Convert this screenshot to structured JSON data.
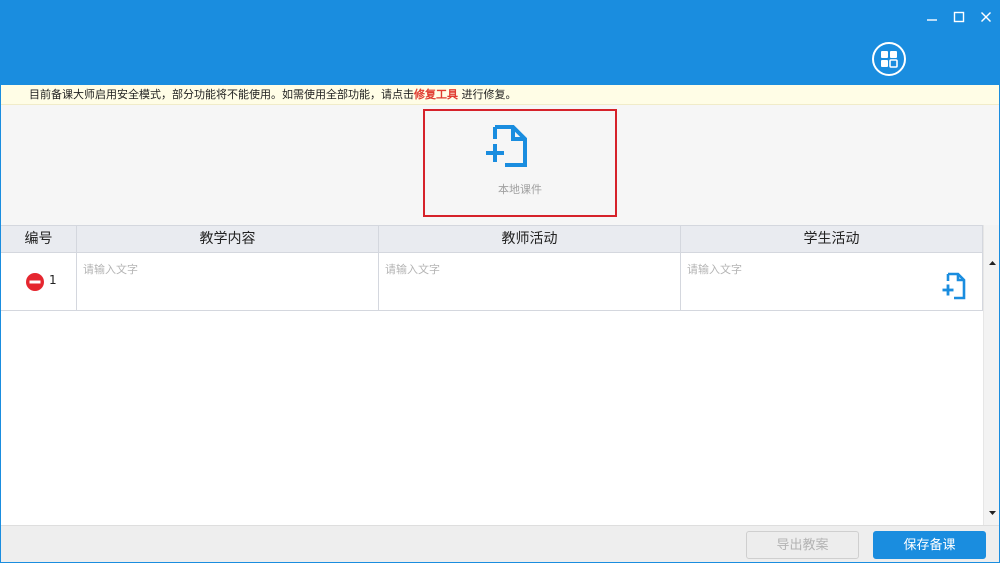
{
  "window": {
    "controls": {
      "minimize": "—",
      "maximize": "☐",
      "close": "✕"
    },
    "apps_icon": "grid-apps-icon",
    "accent_color": "#1a8ddf"
  },
  "notice": {
    "text_before": "目前备课大师启用安全模式，部分功能将不能使用。如需使用全部功能，请点击",
    "link_text": "修复工具",
    "text_after": " 进行修复。",
    "link_color": "#e03c31"
  },
  "upload": {
    "icon": "add-document-icon",
    "label": "本地课件",
    "highlight_color": "#d6222a"
  },
  "table": {
    "columns": [
      "编号",
      "教学内容",
      "教师活动",
      "学生活动"
    ],
    "rows": [
      {
        "number": "1",
        "teaching_content": {
          "value": "",
          "placeholder": "请输入文字"
        },
        "teacher_activity": {
          "value": "",
          "placeholder": "请输入文字"
        },
        "student_activity": {
          "value": "",
          "placeholder": "请输入文字"
        }
      }
    ]
  },
  "footer": {
    "export_label": "导出教案",
    "save_label": "保存备课"
  }
}
